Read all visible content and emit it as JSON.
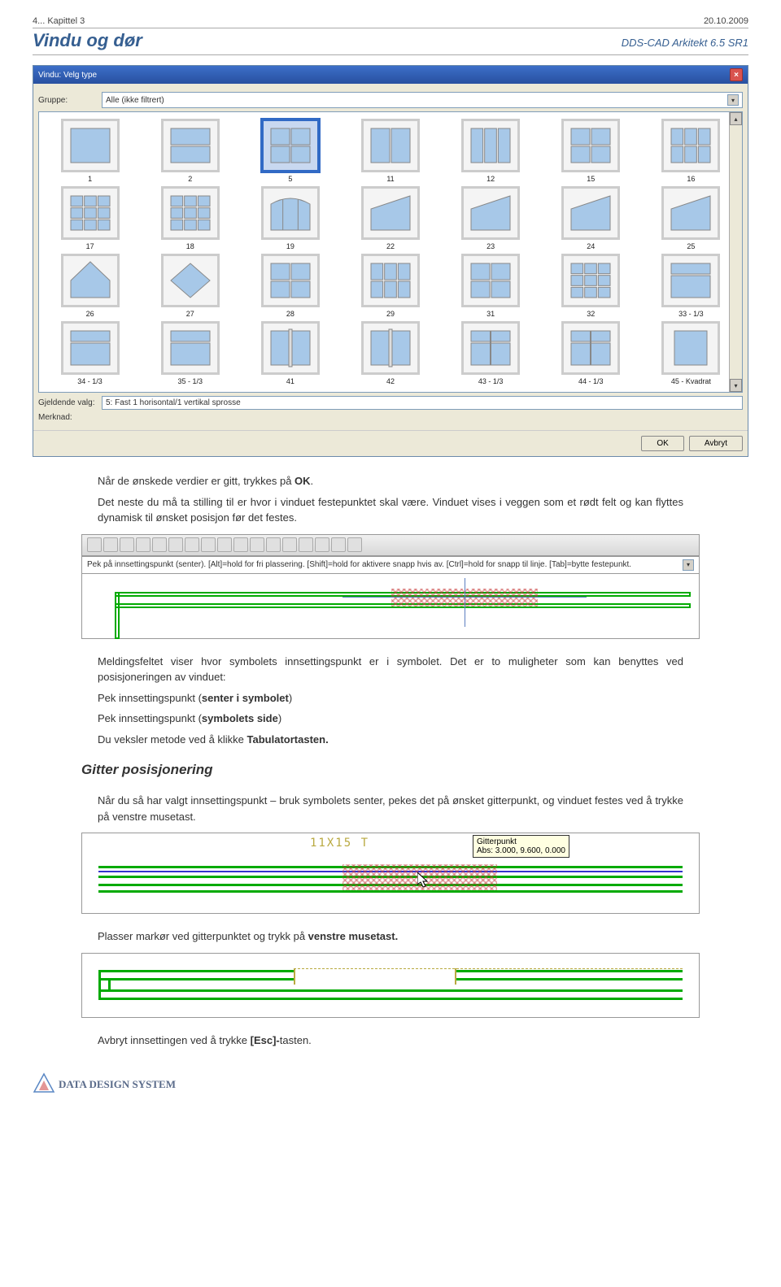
{
  "header": {
    "chapter": "4... Kapittel 3",
    "date": "20.10.2009",
    "title": "Vindu og dør",
    "product": "DDS-CAD Arkitekt 6.5 SR1"
  },
  "dialog": {
    "title": "Vindu: Velg type",
    "group_label": "Gruppe:",
    "group_value": "Alle (ikke filtrert)",
    "current_label": "Gjeldende valg:",
    "current_value": "5: Fast 1 horisontal/1 vertikal sprosse",
    "note_label": "Merknad:",
    "ok": "OK",
    "cancel": "Avbryt",
    "items": [
      {
        "id": "1",
        "name": "1",
        "selected": false,
        "type": "plain"
      },
      {
        "id": "2",
        "name": "2",
        "selected": false,
        "type": "hsplit"
      },
      {
        "id": "5",
        "name": "5",
        "selected": true,
        "type": "cross"
      },
      {
        "id": "11",
        "name": "11",
        "selected": false,
        "type": "vsplit"
      },
      {
        "id": "12",
        "name": "12",
        "selected": false,
        "type": "v3"
      },
      {
        "id": "15",
        "name": "15",
        "selected": false,
        "type": "grid22"
      },
      {
        "id": "16",
        "name": "16",
        "selected": false,
        "type": "grid23"
      },
      {
        "id": "17",
        "name": "17",
        "selected": false,
        "type": "grid33"
      },
      {
        "id": "18",
        "name": "18",
        "selected": false,
        "type": "grid33b"
      },
      {
        "id": "19",
        "name": "19",
        "selected": false,
        "type": "arch3"
      },
      {
        "id": "22",
        "name": "22",
        "selected": false,
        "type": "trap1"
      },
      {
        "id": "23",
        "name": "23",
        "selected": false,
        "type": "trap2"
      },
      {
        "id": "24",
        "name": "24",
        "selected": false,
        "type": "trap3"
      },
      {
        "id": "25",
        "name": "25",
        "selected": false,
        "type": "trap4"
      },
      {
        "id": "26",
        "name": "26",
        "selected": false,
        "type": "pent"
      },
      {
        "id": "27",
        "name": "27",
        "selected": false,
        "type": "diamond"
      },
      {
        "id": "28",
        "name": "28",
        "selected": false,
        "type": "wide22"
      },
      {
        "id": "29",
        "name": "29",
        "selected": false,
        "type": "wide23"
      },
      {
        "id": "31",
        "name": "31",
        "selected": false,
        "type": "wide24"
      },
      {
        "id": "32",
        "name": "32",
        "selected": false,
        "type": "wide33"
      },
      {
        "id": "33",
        "name": "33 - 1/3",
        "selected": false,
        "type": "top13"
      },
      {
        "id": "34",
        "name": "34 - 1/3",
        "selected": false,
        "type": "top13b"
      },
      {
        "id": "35",
        "name": "35 - 1/3",
        "selected": false,
        "type": "top13c"
      },
      {
        "id": "41",
        "name": "41",
        "selected": false,
        "type": "mull2"
      },
      {
        "id": "42",
        "name": "42",
        "selected": false,
        "type": "mull3"
      },
      {
        "id": "43",
        "name": "43 - 1/3",
        "selected": false,
        "type": "mull13"
      },
      {
        "id": "44",
        "name": "44 - 1/3",
        "selected": false,
        "type": "mull13b"
      },
      {
        "id": "45",
        "name": "45 - Kvadrat",
        "selected": false,
        "type": "square"
      }
    ]
  },
  "para1_a": "Når de ønskede verdier er gitt, trykkes på ",
  "para1_b": "OK",
  "para1_c": ".",
  "para2": "Det neste du må ta stilling til er hvor i vinduet festepunktet skal være. Vinduet vises i veggen som et rødt felt og kan flyttes dynamisk til ønsket posisjon før det festes.",
  "cmdline_text": "Pek på innsettingspunkt (senter). [Alt]=hold for fri plassering. [Shift]=hold for aktivere snapp hvis av. [Ctrl]=hold for snapp til linje. [Tab]=bytte festepunkt.",
  "para3": "Meldingsfeltet viser hvor symbolets innsettingspunkt er i symbolet. Det er to muligheter som kan benyttes ved posisjoneringen av vinduet:",
  "list1_a": "Pek innsettingspunkt (",
  "list1_b": "senter i symbolet",
  "list1_c": ")",
  "list2_a": "Pek innsettingspunkt (",
  "list2_b": "symbolets side",
  "list2_c": ")",
  "list3_a": "Du veksler metode ved å klikke ",
  "list3_b": "Tabulatortasten.",
  "heading2": "Gitter posisjonering",
  "para4": "Når du så har valgt innsettingspunkt – bruk symbolets senter, pekes det på ønsket gitterpunkt, og vinduet festes ved å trykke på venstre musetast.",
  "fig2_label": "11X15 T",
  "fig2_tooltip": "Gitterpunkt\nAbs: 3.000, 9.600, 0.000",
  "para5_a": "Plasser markør ved gitterpunktet og trykk på ",
  "para5_b": "venstre musetast.",
  "para6_a": "Avbryt innsettingen ved å trykke ",
  "para6_b": "[Esc]-",
  "para6_c": "tasten.",
  "footer_brand": "DATA DESIGN SYSTEM"
}
